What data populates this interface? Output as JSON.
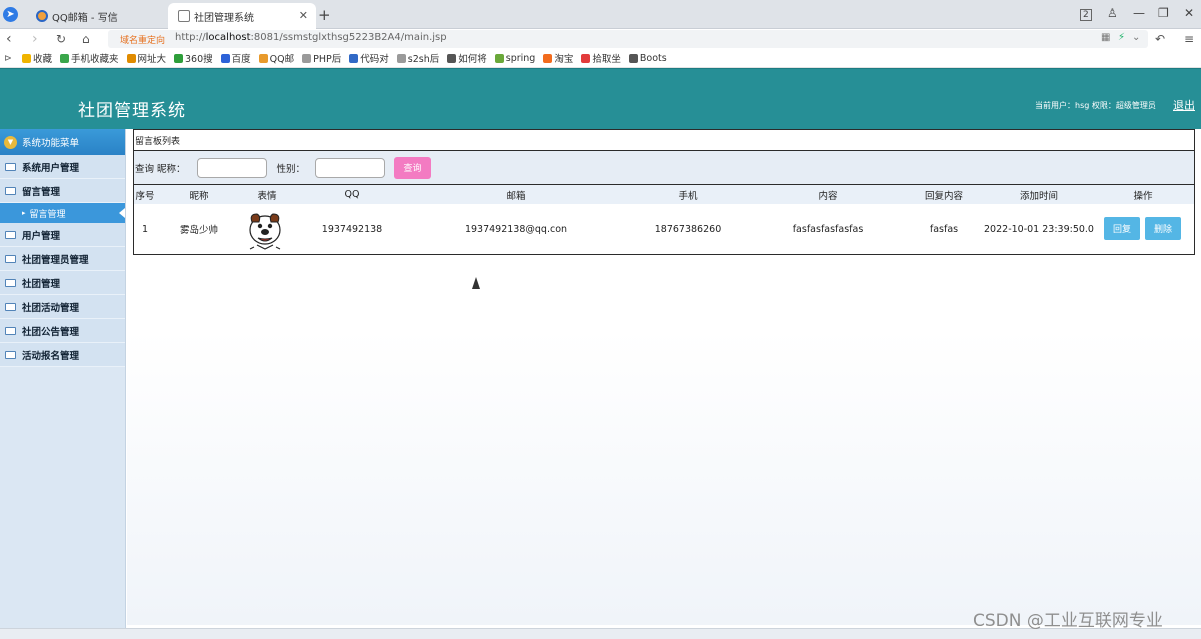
{
  "browser": {
    "tabs": [
      {
        "label": "QQ邮箱 - 写信"
      },
      {
        "label": "社团管理系统"
      }
    ],
    "tab_count_badge": "2",
    "redirect_label": "域名重定向",
    "url_prefix": "http://",
    "url_host": "localhost",
    "url_rest": ":8081/ssmstglxthsg5223B2A4/main.jsp",
    "bookmarks": [
      {
        "label": "收藏",
        "color": "#f0b400"
      },
      {
        "label": "手机收藏夹",
        "color": "#3aa64b"
      },
      {
        "label": "网址大",
        "color": "#e08b00"
      },
      {
        "label": "360搜",
        "color": "#2e9e3a"
      },
      {
        "label": "百度",
        "color": "#2d62d8"
      },
      {
        "label": "QQ邮",
        "color": "#e89a2c"
      },
      {
        "label": "PHP后",
        "color": "#9a9a9a"
      },
      {
        "label": "代码对",
        "color": "#3169c6"
      },
      {
        "label": "s2sh后",
        "color": "#9a9a9a"
      },
      {
        "label": "如何将",
        "color": "#555555"
      },
      {
        "label": "spring",
        "color": "#6aa83a"
      },
      {
        "label": "淘宝",
        "color": "#f26b1d"
      },
      {
        "label": "拾取坐",
        "color": "#e23b3b"
      },
      {
        "label": "Boots",
        "color": "#555555"
      }
    ]
  },
  "header": {
    "title": "社团管理系统",
    "user_label": "当前用户：hsg 权限：超级管理员",
    "logout": "退出",
    "bg_color": "#268f96"
  },
  "sidebar": {
    "heading": "系统功能菜单",
    "items": [
      {
        "label": "系统用户管理"
      },
      {
        "label": "留言管理",
        "sub": "留言管理"
      },
      {
        "label": "用户管理"
      },
      {
        "label": "社团管理员管理"
      },
      {
        "label": "社团管理"
      },
      {
        "label": "社团活动管理"
      },
      {
        "label": "社团公告管理"
      },
      {
        "label": "活动报名管理"
      }
    ]
  },
  "content": {
    "section_title": "留言板列表",
    "search": {
      "prefix": "查询 昵称：",
      "gender_label": "性别：",
      "nickname_value": "",
      "gender_value": "",
      "button": "查询"
    },
    "table": {
      "columns": [
        "序号",
        "昵称",
        "表情",
        "QQ",
        "邮箱",
        "手机",
        "内容",
        "回复内容",
        "添加时间",
        "操作"
      ],
      "rows": [
        {
          "index": "1",
          "nickname": "雾岛少帅",
          "qq": "1937492138",
          "email": "1937492138@qq.con",
          "phone": "18767386260",
          "content": "fasfasfasfasfas",
          "reply": "fasfas",
          "time": "2022-10-01 23:39:50.0",
          "reply_btn": "回复",
          "delete_btn": "删除"
        }
      ]
    }
  },
  "watermark": "CSDN @工业互联网专业"
}
